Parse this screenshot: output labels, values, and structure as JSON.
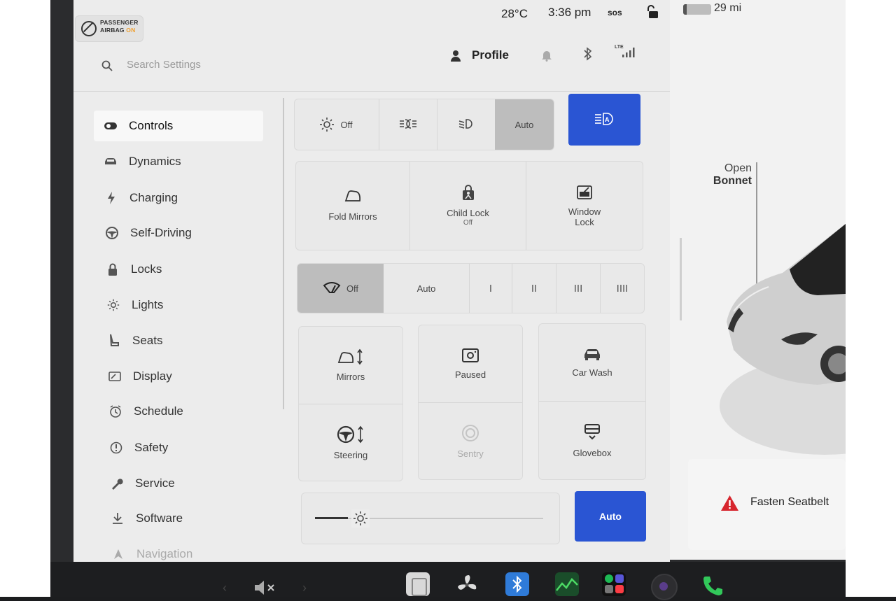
{
  "status": {
    "airbag_line1": "PASSENGER",
    "airbag_line2": "AIRBAG",
    "airbag_state": "ON",
    "temperature": "28°C",
    "time": "3:36 pm",
    "sos": "sos",
    "range": "29 mi"
  },
  "header": {
    "search_placeholder": "Search Settings",
    "profile_label": "Profile",
    "lte_label": "LTE"
  },
  "sidebar": {
    "items": [
      {
        "label": "Controls",
        "icon": "toggle-icon"
      },
      {
        "label": "Dynamics",
        "icon": "car-icon"
      },
      {
        "label": "Charging",
        "icon": "bolt-icon"
      },
      {
        "label": "Self-Driving",
        "icon": "steering-wheel-icon"
      },
      {
        "label": "Locks",
        "icon": "lock-icon"
      },
      {
        "label": "Lights",
        "icon": "sun-icon"
      },
      {
        "label": "Seats",
        "icon": "seat-icon"
      },
      {
        "label": "Display",
        "icon": "display-icon"
      },
      {
        "label": "Schedule",
        "icon": "clock-icon"
      },
      {
        "label": "Safety",
        "icon": "alert-circle-icon"
      },
      {
        "label": "Service",
        "icon": "wrench-icon"
      },
      {
        "label": "Software",
        "icon": "download-icon"
      },
      {
        "label": "Navigation",
        "icon": "navigation-icon"
      }
    ]
  },
  "lights": {
    "off_label": "Off",
    "auto_label": "Auto",
    "selected": "Auto"
  },
  "mirrors_row": {
    "fold_mirrors": "Fold Mirrors",
    "child_lock": "Child Lock",
    "child_lock_state": "Off",
    "window_lock_1": "Window",
    "window_lock_2": "Lock"
  },
  "wipers": {
    "off_label": "Off",
    "auto_label": "Auto",
    "speeds": [
      "I",
      "II",
      "III",
      "IIII"
    ],
    "selected": "Off"
  },
  "tiles": {
    "mirrors": "Mirrors",
    "paused": "Paused",
    "car_wash": "Car Wash",
    "steering": "Steering",
    "sentry": "Sentry",
    "glovebox": "Glovebox"
  },
  "brightness": {
    "auto_label": "Auto",
    "level": 0.2
  },
  "car": {
    "open_label_1": "Open",
    "open_label_2": "Bonnet"
  },
  "alert": {
    "text": "Fasten Seatbelt"
  },
  "colors": {
    "accent_blue": "#2a55d3",
    "alert_red": "#d7262e",
    "airbag_on": "#f0a030"
  }
}
